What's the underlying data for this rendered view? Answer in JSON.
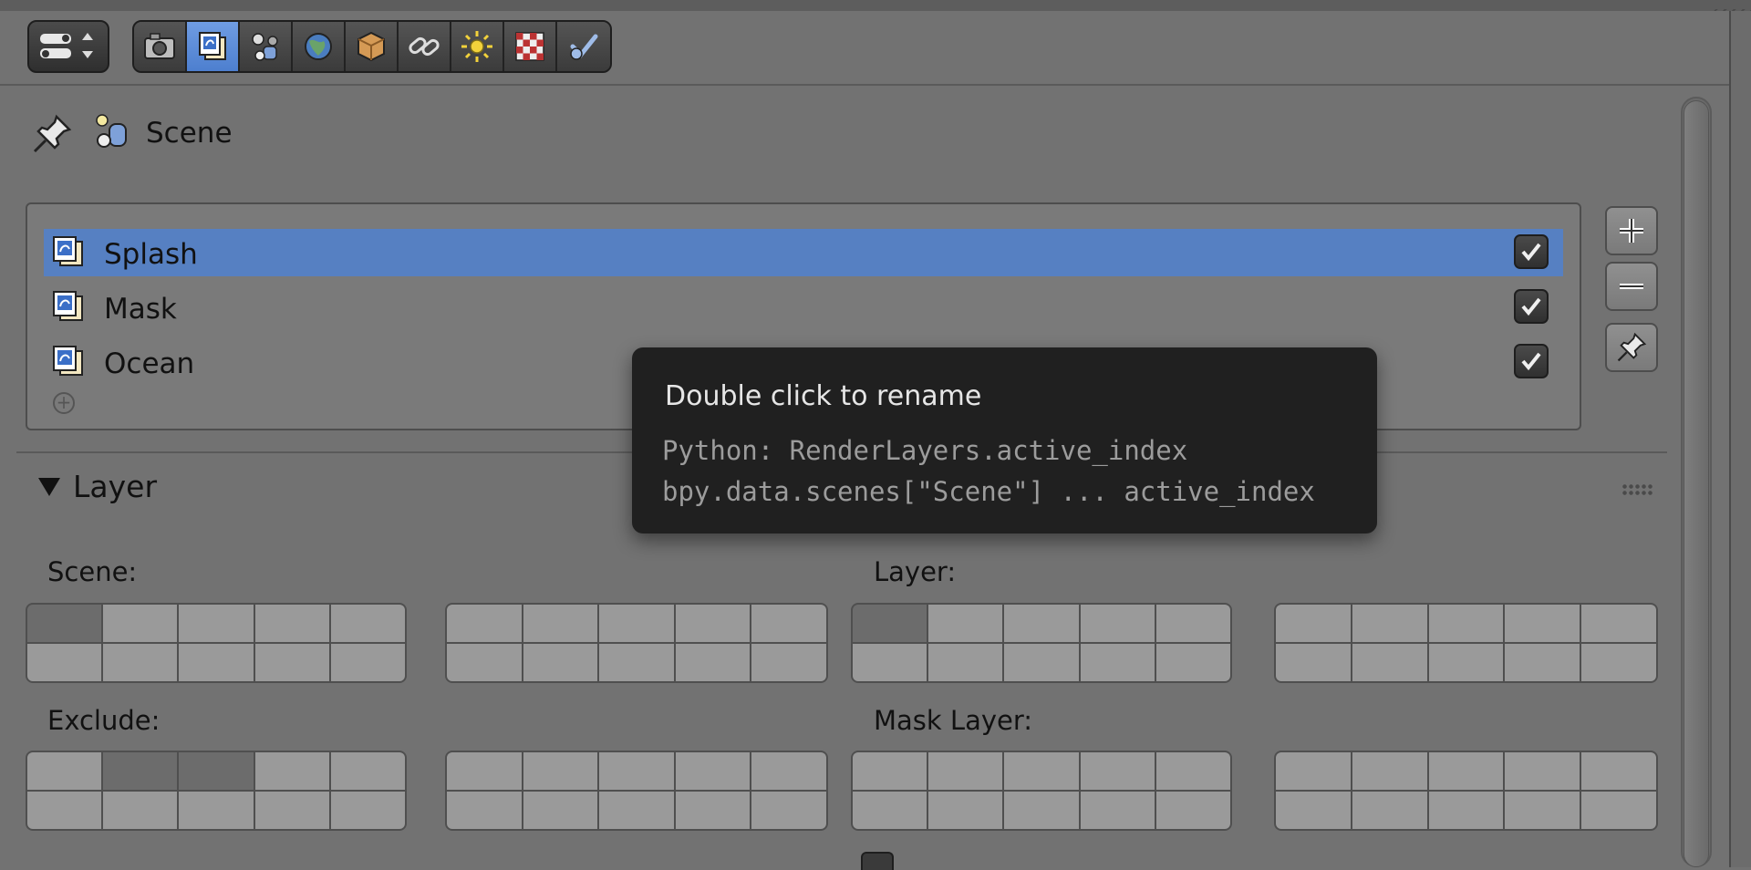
{
  "header": {
    "editor_type_icon": "properties-editor-icon",
    "tabs": [
      {
        "name": "render",
        "icon": "camera-icon"
      },
      {
        "name": "render-layers",
        "icon": "render-layers-icon",
        "active": true
      },
      {
        "name": "scene",
        "icon": "scene-icon"
      },
      {
        "name": "world",
        "icon": "world-icon"
      },
      {
        "name": "object",
        "icon": "cube-icon"
      },
      {
        "name": "constraints",
        "icon": "link-icon"
      },
      {
        "name": "lamp",
        "icon": "sun-icon"
      },
      {
        "name": "texture",
        "icon": "checker-icon"
      },
      {
        "name": "physics",
        "icon": "check-node-icon"
      }
    ]
  },
  "breadcrumb": {
    "scene_label": "Scene"
  },
  "layers_list": {
    "items": [
      {
        "label": "Splash",
        "selected": true,
        "enabled": true
      },
      {
        "label": "Mask",
        "selected": false,
        "enabled": true
      },
      {
        "label": "Ocean",
        "selected": false,
        "enabled": true
      }
    ]
  },
  "tooltip": {
    "title": "Double click to rename",
    "line1": "Python: RenderLayers.active_index",
    "line2": "bpy.data.scenes[\"Scene\"] ... active_index"
  },
  "layer_panel": {
    "title": "Layer",
    "scene_label": "Scene:",
    "layer_label": "Layer:",
    "exclude_label": "Exclude:",
    "mask_layer_label": "Mask Layer:"
  },
  "colors": {
    "background": "#727272",
    "selection": "#5680c2",
    "tooltip_bg": "#202020",
    "active_tab": "#5a8ad6"
  }
}
